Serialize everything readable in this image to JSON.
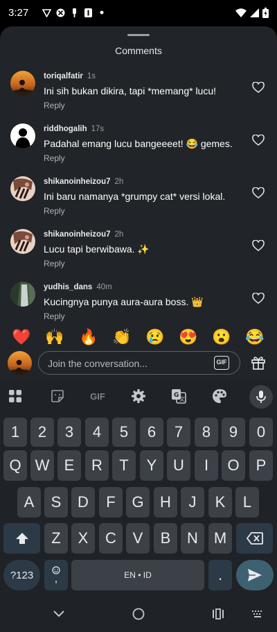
{
  "status_bar": {
    "time": "3:27"
  },
  "sheet": {
    "title": "Comments"
  },
  "comments": [
    {
      "user": "toriqalfatir",
      "time": "1s",
      "text": "Ini sih bukan dikira, tapi *memang* lucu!",
      "reply": "Reply",
      "avatar": "sunset"
    },
    {
      "user": "riddhogalih",
      "time": "17s",
      "text": "Padahal emang lucu bangeeeet! 😂 gemes.",
      "reply": "Reply",
      "avatar": "silhouette"
    },
    {
      "user": "shikanoinheizou7",
      "time": "2h",
      "text": "Ini baru namanya *grumpy cat* versi lokal.",
      "reply": "Reply",
      "avatar": "anime"
    },
    {
      "user": "shikanoinheizou7",
      "time": "2h",
      "text": "Lucu tapi berwibawa. ✨",
      "reply": "Reply",
      "avatar": "anime"
    },
    {
      "user": "yudhis_dans",
      "time": "40m",
      "text": "Kucingnya punya aura-aura boss. 👑",
      "reply": "Reply",
      "avatar": "waterfall"
    }
  ],
  "emoji_bar": [
    "❤️",
    "🙌",
    "🔥",
    "👏",
    "😢",
    "😍",
    "😮",
    "😂"
  ],
  "compose": {
    "placeholder": "Join the conversation...",
    "gif_label": "GIF"
  },
  "keyboard": {
    "toolbar_gif": "GIF",
    "number_row": [
      "1",
      "2",
      "3",
      "4",
      "5",
      "6",
      "7",
      "8",
      "9",
      "0"
    ],
    "row1": [
      "Q",
      "W",
      "E",
      "R",
      "T",
      "Y",
      "U",
      "I",
      "O",
      "P"
    ],
    "row2": [
      "A",
      "S",
      "D",
      "F",
      "G",
      "H",
      "J",
      "K",
      "L"
    ],
    "row3": [
      "Z",
      "X",
      "C",
      "V",
      "B",
      "N",
      "M"
    ],
    "symbols_key": "?123",
    "emoji_comma_key": ",",
    "space_label": "EN • ID",
    "period_key": "."
  }
}
